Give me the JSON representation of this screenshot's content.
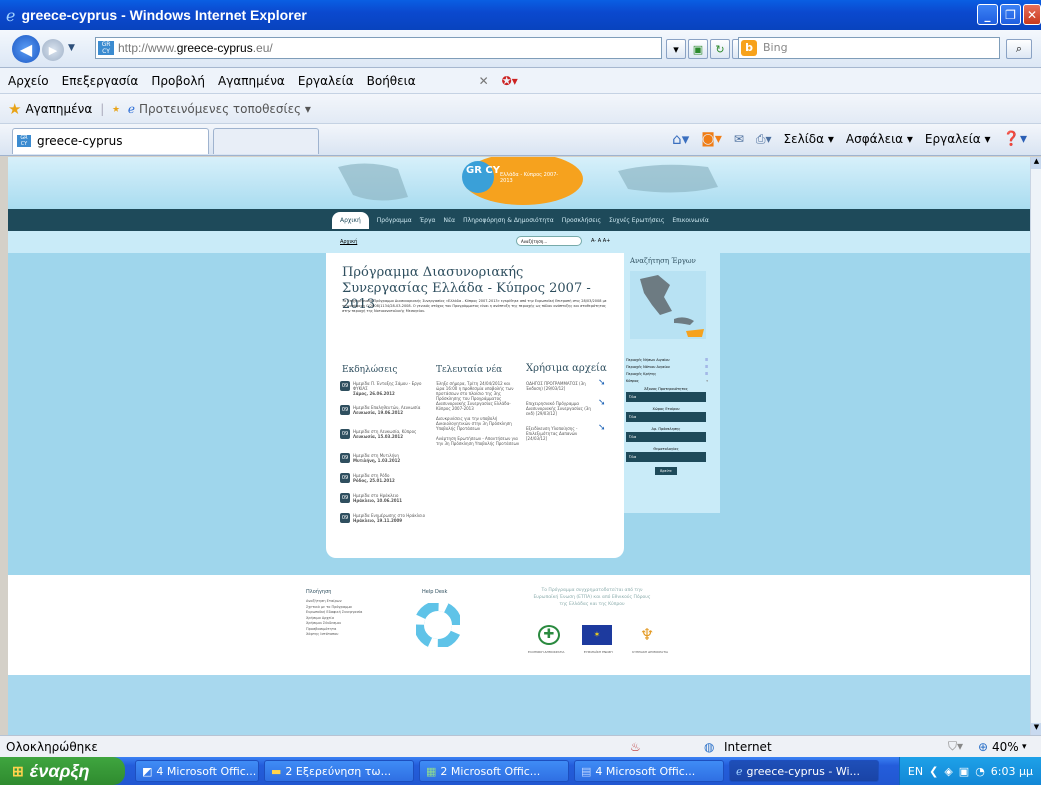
{
  "window": {
    "title": "greece-cyprus - Windows Internet Explorer"
  },
  "address": {
    "url_prefix": "http://www.",
    "url_domain": "greece-cyprus",
    "url_suffix": ".eu/",
    "search_placeholder": "Bing"
  },
  "menu": [
    "Αρχείο",
    "Επεξεργασία",
    "Προβολή",
    "Αγαπημένα",
    "Εργαλεία",
    "Βοήθεια"
  ],
  "favorites": {
    "label": "Αγαπημένα",
    "suggested": "Προτεινόμενες τοποθεσίες ▾"
  },
  "tab": {
    "label": "greece-cyprus"
  },
  "commands": {
    "page": "Σελίδα ▾",
    "safety": "Ασφάλεια ▾",
    "tools": "Εργαλεία ▾"
  },
  "site": {
    "logo_text": "GR CY",
    "banner_text": "Ελλάδα - Κύπρος 2007-2013",
    "nav": [
      "Αρχική",
      "Πρόγραμμα",
      "Έργα",
      "Νέα",
      "Πληροφόρηση & Δημοσιότητα",
      "Προσκλήσεις",
      "Συχνές Ερωτήσεις",
      "Επικοινωνία"
    ],
    "sub_left": "Αρχική",
    "search_value": "Αναζήτηση...",
    "font_size": "A- A A+",
    "headline": "Πρόγραμμα Διασυνοριακής Συνεργασίας Ελλάδα - Κύπρος 2007 - 2013",
    "intro": "Το Επιχειρησιακό Πρόγραμμα Διασυνοριακής Συνεργασίας «Ελλάδα - Κύπρος 2007-2013» εγκρίθηκε από την Ευρωπαϊκή Επιτροπή στις 28/03/2008 με την απόφαση C(2008)1134/28-03-2008. Ο γενικός στόχος του Προγράμματος είναι η ανάπτυξη της περιοχής ως πόλου ανάπτυξης και σταθερότητας στην περιοχή της Νοτιοανατολικής Μεσογείου.",
    "col_events": "Εκδηλώσεις",
    "col_news": "Τελευταία νέα",
    "col_files": "Χρήσιμα αρχεία",
    "events": [
      {
        "title": "Ημερίδα Π. Ένταξης Σάμου - Εργο ΦΥΚΙΑΣ",
        "meta": "Σάμος, 26.06.2012"
      },
      {
        "title": "Ημερίδα Επαληθευτών, Λευκωσία",
        "meta": "Λευκωσία, 19.06.2012"
      },
      {
        "title": "Ημερίδα στη Λευκωσία, Κύπρος",
        "meta": "Λευκωσία, 15.03.2012"
      },
      {
        "title": "Ημερίδα στη Μυτιλήνη",
        "meta": "Μυτιλήνη, 1.03.2012"
      },
      {
        "title": "Ημερίδα στη Ρόδο",
        "meta": "Ρόδος, 25.01.2012"
      },
      {
        "title": "Ημερίδα στο Ηράκλειο",
        "meta": "Ηράκλειο, 10.06.2011"
      },
      {
        "title": "Ημερίδα Ενημέρωσης στο Ηράκλειο",
        "meta": "Ηράκλειο, 19.11.2009"
      }
    ],
    "event_icon_num": "09",
    "news": [
      "Έληξε σήμερα, Τρίτη 24/04/2012 και ώρα 16:00 η προθεσμία υποβολής των προτάσεων στο πλαίσιο της 3ης Πρόσκλησης του Προγράμματος Διασυνοριακής Συνεργασίας Ελλάδα-Κύπρος 2007-2013",
      "Διευκρινίσεις για την υποβολή Δικαιολογητικών στην 3η Πρόσκληση Υποβολής Προτάσεων",
      "Ανάρτηση Ερωτήσεων - Απαντήσεων για την 3η Πρόσκληση Υποβολής Προτάσεων"
    ],
    "files": [
      "ΟΔΗΓΟΣ ΠΡΟΓΡΑΜΜΑΤΟΣ (3η Έκδοση) [29/03/12]",
      "Επιχειρησιακό Πρόγραμμα Διασυνοριακής Συνεργασίας (3η εκδ) [29/03/12]",
      "Εξειδίκευση Υλοποίησης - Επιλεξιμότητας Δαπανών [24/03/12]"
    ],
    "project_search": "Αναζήτηση Έργων",
    "right_links": [
      "Περιοχές Νήσων Αιγαίου",
      "Περιοχές Νότιου Αιγαίου",
      "Περιοχές Κρήτης",
      "Κύπρος"
    ],
    "right_labels": [
      "Άξονας Προτεραιότητας",
      "Χώρος Εταίρου",
      "Αρ. Πρόσκλησης",
      "Θεματολογίας"
    ],
    "right_select": "Όλα",
    "right_button": "Βρείτε",
    "footer_sitemap": "Πλοήγηση",
    "footer_links": [
      "Αναζήτηση Εταίρων",
      "Σχετικά με το Πρόγραμμα",
      "Ευρωπαϊκή Εδαφική Συνεργασία",
      "Χρήσιμα Αρχεία",
      "Χρήσιμοι Σύνδεσμοι",
      "Προσβασιμότητα",
      "Χάρτης Ιστότοπου"
    ],
    "footer_helpdesk": "Help Desk",
    "footer_fund": "Το Πρόγραμμα συγχρηματοδοτείται από την Ευρωπαϊκή Ένωση (ΕΤΠΑ) και από Εθνικούς Πόρους της Ελλάδας και της Κύπρου",
    "footer_logos": [
      "ΕΛΛΗΝΙΚΗ ΔΗΜΟΚΡΑΤΙΑ",
      "ΕΥΡΩΠΑΪΚΗ ΕΝΩΣΗ",
      "ΚΥΠΡΙΑΚΗ ΔΗΜΟΚΡΑΤΙΑ"
    ]
  },
  "status": {
    "left": "Ολοκληρώθηκε",
    "zone": "Internet",
    "zoom": "40%"
  },
  "taskbar": {
    "start": "έναρξη",
    "items": [
      "4 Microsoft Offic...",
      "2 Εξερεύνηση τω...",
      "2 Microsoft Offic...",
      "4 Microsoft Offic...",
      "greece-cyprus - Wi..."
    ],
    "lang": "EN",
    "clock": "6:03 μμ"
  },
  "colors": {
    "site_nav": "#1e4a5a",
    "banner": "#a9dcf0",
    "page_bg": "#9fd6ec",
    "accent_orange": "#f6a21e"
  }
}
